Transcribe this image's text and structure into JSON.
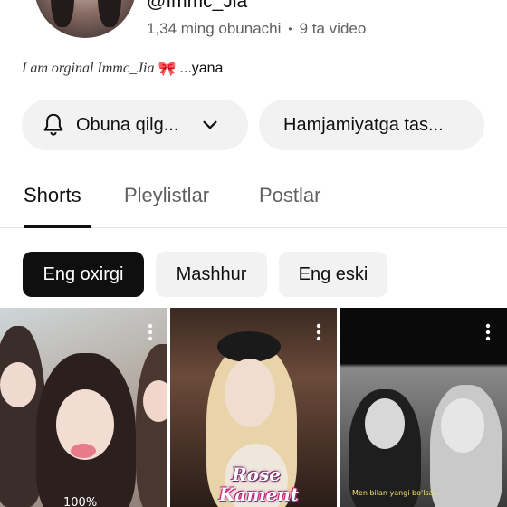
{
  "channel": {
    "handle": "@Immc_Jia",
    "subscribers": "1,34 ming obunachi",
    "video_count": "9 ta video",
    "bio_text": "I am orginal Immc_Jia",
    "bio_more": "...yana"
  },
  "actions": {
    "subscribe_label": "Obuna qilg...",
    "community_label": "Hamjamiyatga tas..."
  },
  "tabs": [
    {
      "label": "Shorts",
      "active": true
    },
    {
      "label": "Pleylistlar",
      "active": false
    },
    {
      "label": "Postlar",
      "active": false
    }
  ],
  "filters": [
    {
      "label": "Eng oxirgi",
      "selected": true
    },
    {
      "label": "Mashhur",
      "selected": false
    },
    {
      "label": "Eng eski",
      "selected": false
    }
  ],
  "shorts": [
    {
      "overlay_text": "100%"
    },
    {
      "overlay_title": "Rose",
      "overlay_subtitle": "Kament"
    },
    {
      "overlay_text": "Men bilan yangi bo'lsa..."
    }
  ],
  "icons": {
    "bell": "bell-icon",
    "chevron": "chevron-down-icon",
    "more": "more-vert-icon",
    "bow": "ribbon-emoji"
  },
  "colors": {
    "chip_selected_bg": "#0f0f0f",
    "chip_bg": "#f2f2f2",
    "secondary_text": "#606060"
  }
}
